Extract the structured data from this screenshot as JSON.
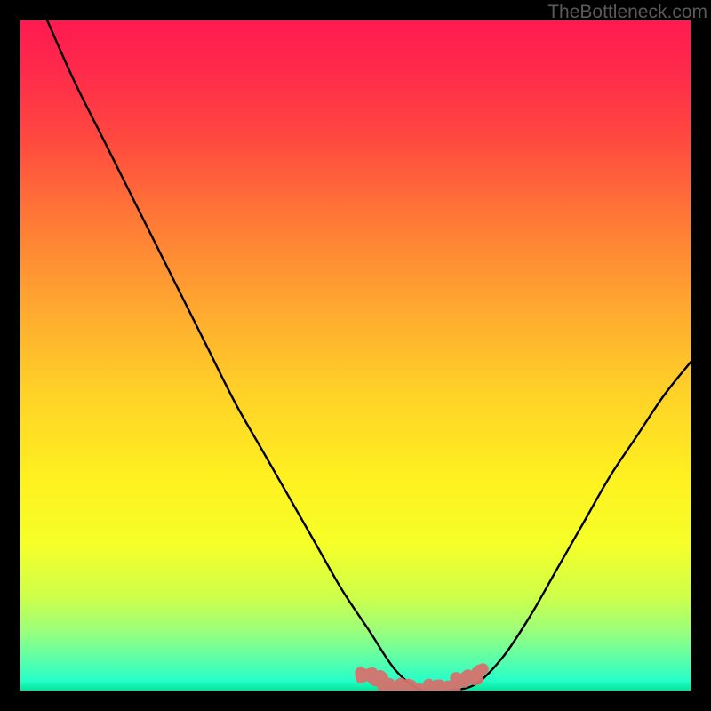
{
  "watermark": "TheBottleneck.com",
  "colors": {
    "frame": "#000000",
    "gradient_stops": [
      {
        "offset": 0.0,
        "color": "#ff1a51"
      },
      {
        "offset": 0.08,
        "color": "#ff2b4a"
      },
      {
        "offset": 0.18,
        "color": "#ff4a3f"
      },
      {
        "offset": 0.3,
        "color": "#ff7a36"
      },
      {
        "offset": 0.42,
        "color": "#ffa530"
      },
      {
        "offset": 0.55,
        "color": "#ffd028"
      },
      {
        "offset": 0.68,
        "color": "#fff020"
      },
      {
        "offset": 0.78,
        "color": "#f6ff28"
      },
      {
        "offset": 0.86,
        "color": "#ceff4a"
      },
      {
        "offset": 0.91,
        "color": "#9cff7a"
      },
      {
        "offset": 0.95,
        "color": "#60ffa6"
      },
      {
        "offset": 0.985,
        "color": "#26ffc8"
      },
      {
        "offset": 1.0,
        "color": "#00e69a"
      }
    ],
    "curve": "#000000",
    "squiggle": "#d6716d"
  },
  "chart_data": {
    "type": "line",
    "title": "",
    "xlabel": "",
    "ylabel": "",
    "xlim": [
      0,
      100
    ],
    "ylim": [
      0,
      100
    ],
    "grid": false,
    "legend": false,
    "series": [
      {
        "name": "bottleneck-curve",
        "x": [
          4,
          8,
          12,
          16,
          20,
          24,
          28,
          32,
          36,
          40,
          44,
          48,
          52,
          56,
          60,
          64,
          68,
          72,
          76,
          80,
          84,
          88,
          92,
          96,
          100
        ],
        "y": [
          100,
          91,
          83,
          75,
          67,
          59,
          51,
          43,
          36,
          29,
          22,
          15,
          9,
          3,
          0,
          0,
          1,
          5,
          11,
          18,
          25,
          32,
          38,
          44,
          49
        ]
      },
      {
        "name": "optimal-zone-marker",
        "x": [
          51,
          53,
          55,
          57,
          59,
          61,
          63,
          65,
          67,
          69
        ],
        "y": [
          3.0,
          1.6,
          0.8,
          0.3,
          0.1,
          0.1,
          0.3,
          0.9,
          1.9,
          3.2
        ]
      }
    ],
    "annotations": [
      {
        "text": "TheBottleneck.com",
        "position": "top-right"
      }
    ]
  }
}
